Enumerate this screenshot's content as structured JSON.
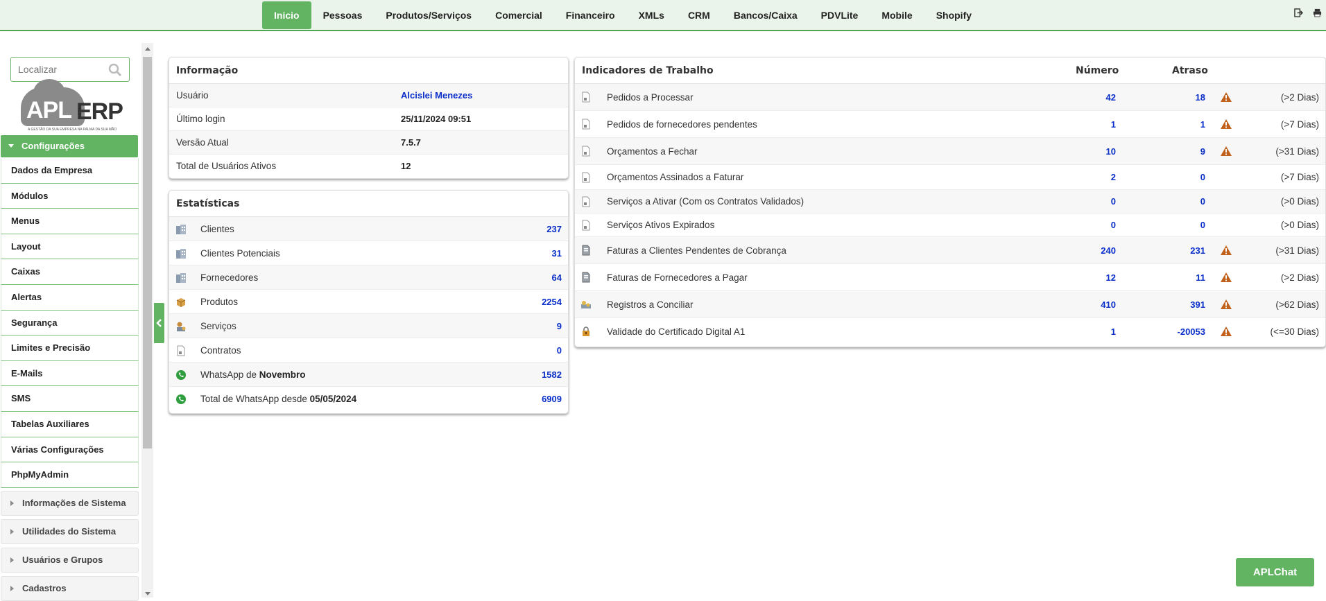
{
  "topnav": {
    "tabs": [
      "Inicio",
      "Pessoas",
      "Produtos/Serviços",
      "Comercial",
      "Financeiro",
      "XMLs",
      "CRM",
      "Bancos/Caixa",
      "PDVLite",
      "Mobile",
      "Shopify"
    ],
    "active": "Inicio",
    "icons": [
      "logout-icon",
      "print-icon"
    ]
  },
  "sidebar": {
    "search_placeholder": "Localizar",
    "logo": {
      "part1": "APL",
      "part2": "ERP",
      "tagline": "A GESTÃO DA SUA EMPRESA NA PALMA DA SUA MÃO"
    },
    "active_section": "Configurações",
    "items": [
      "Dados da Empresa",
      "Módulos",
      "Menus",
      "Layout",
      "Caixas",
      "Alertas",
      "Segurança",
      "Limites e Precisão",
      "E-Mails",
      "SMS",
      "Tabelas Auxiliares",
      "Várias Configurações",
      "PhpMyAdmin"
    ],
    "groups": [
      "Informações de Sistema",
      "Utilidades do Sistema",
      "Usuários e Grupos",
      "Cadastros"
    ]
  },
  "info": {
    "title": "Informação",
    "rows": [
      {
        "label": "Usuário",
        "value": "Alcislei Menezes"
      },
      {
        "label": "Último login",
        "value": "25/11/2024 09:51"
      },
      {
        "label": "Versão Atual",
        "value": "7.5.7"
      },
      {
        "label": "Total de Usuários Ativos",
        "value": "12"
      }
    ]
  },
  "stats": {
    "title": "Estatísticas",
    "rows": [
      {
        "label": "Clientes",
        "value": "237",
        "icon": "building-icon"
      },
      {
        "label": "Clientes Potenciais",
        "value": "31",
        "icon": "building-icon"
      },
      {
        "label": "Fornecedores",
        "value": "64",
        "icon": "building-icon"
      },
      {
        "label": "Produtos",
        "value": "2254",
        "icon": "box-icon"
      },
      {
        "label": "Serviços",
        "value": "9",
        "icon": "service-icon"
      },
      {
        "label": "Contratos",
        "value": "0",
        "icon": "document-icon"
      },
      {
        "label_prefix": "WhatsApp de ",
        "label_bold": "Novembro",
        "value": "1582",
        "icon": "whatsapp-icon"
      },
      {
        "label_prefix": "Total de WhatsApp desde ",
        "label_bold": "05/05/2024",
        "value": "6909",
        "icon": "whatsapp-icon"
      }
    ]
  },
  "indicators": {
    "title": "Indicadores de Trabalho",
    "col_numero": "Número",
    "col_atraso": "Atraso",
    "rows": [
      {
        "label": "Pedidos a Processar",
        "numero": "42",
        "atraso": "18",
        "warn": true,
        "days": "(>2 Dias)",
        "icon": "document-icon"
      },
      {
        "label": "Pedidos de fornecedores pendentes",
        "numero": "1",
        "atraso": "1",
        "warn": true,
        "days": "(>7 Dias)",
        "icon": "document-icon"
      },
      {
        "label": "Orçamentos a Fechar",
        "numero": "10",
        "atraso": "9",
        "warn": true,
        "days": "(>31 Dias)",
        "icon": "document-icon"
      },
      {
        "label": "Orçamentos Assinados a Faturar",
        "numero": "2",
        "atraso": "0",
        "warn": false,
        "days": "(>7 Dias)",
        "icon": "document-icon"
      },
      {
        "label": "Serviços a Ativar (Com os Contratos Validados)",
        "numero": "0",
        "atraso": "0",
        "warn": false,
        "days": "(>0 Dias)",
        "icon": "document-icon"
      },
      {
        "label": "Serviços Ativos Expirados",
        "numero": "0",
        "atraso": "0",
        "warn": false,
        "days": "(>0 Dias)",
        "icon": "document-icon"
      },
      {
        "label": "Faturas a Clientes Pendentes de Cobrança",
        "numero": "240",
        "atraso": "231",
        "warn": true,
        "days": "(>31 Dias)",
        "icon": "invoice-icon"
      },
      {
        "label": "Faturas de Fornecedores a Pagar",
        "numero": "12",
        "atraso": "11",
        "warn": true,
        "days": "(>2 Dias)",
        "icon": "invoice-icon"
      },
      {
        "label": "Registros a Conciliar",
        "numero": "410",
        "atraso": "391",
        "warn": true,
        "days": "(>62 Dias)",
        "icon": "bank-icon"
      },
      {
        "label": "Validade do Certificado Digital A1",
        "numero": "1",
        "atraso": "-20053",
        "warn": true,
        "days": "(<=30 Dias)",
        "icon": "lock-icon"
      }
    ]
  },
  "aplchat_label": "APLChat",
  "colors": {
    "accent": "#62b462",
    "link": "#0a2fc9",
    "warning": "#c0601a",
    "topbar_bg": "#eaf4ea"
  }
}
